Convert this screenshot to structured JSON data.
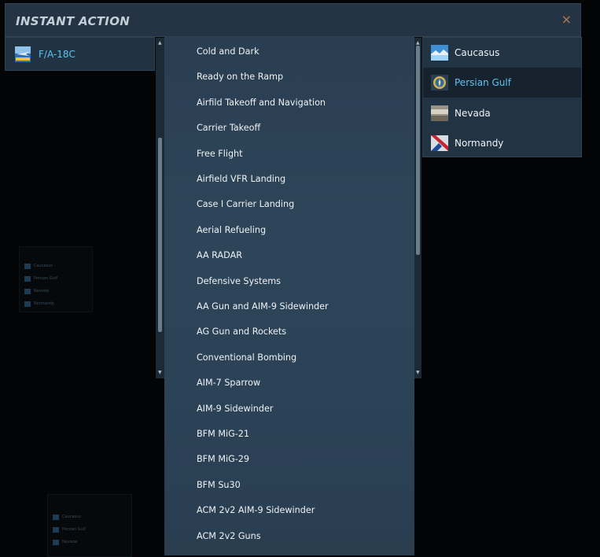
{
  "header": {
    "title": "INSTANT ACTION",
    "close_glyph": "×"
  },
  "aircraft": {
    "items": [
      {
        "label": "F/A-18C",
        "icon": "hornet-icon"
      }
    ]
  },
  "missions": {
    "items": [
      "Cold and Dark",
      "Ready on the Ramp",
      "Airfild Takeoff and Navigation",
      "Carrier Takeoff",
      "Free Flight",
      "Airfield VFR Landing",
      "Case I Carrier Landing",
      "Aerial Refueling",
      "AA RADAR",
      "Defensive Systems",
      "AA Gun and AIM-9 Sidewinder",
      "AG Gun and Rockets",
      "Conventional Bombing",
      "AIM-7 Sparrow",
      "AIM-9 Sidewinder",
      "BFM MiG-21",
      "BFM MiG-29",
      "BFM Su30",
      "ACM 2v2 AIM-9 Sidewinder",
      "ACM 2v2 Guns"
    ]
  },
  "maps": {
    "selected": "Persian Gulf",
    "items": [
      {
        "label": "Caucasus",
        "icon": "caucasus-map-icon"
      },
      {
        "label": "Persian Gulf",
        "icon": "persian-gulf-map-icon"
      },
      {
        "label": "Nevada",
        "icon": "nevada-map-icon"
      },
      {
        "label": "Normandy",
        "icon": "normandy-map-icon"
      }
    ]
  },
  "ghost": {
    "maps_a": [
      "Caucasus",
      "Persian Gulf",
      "Nevada",
      "Normandy"
    ],
    "maps_b": [
      "Caucasus",
      "Persian Gulf",
      "Nevada"
    ]
  },
  "colors": {
    "accent": "#5fc3f0",
    "close": "#b67a4e",
    "header_bg": "#243444"
  }
}
